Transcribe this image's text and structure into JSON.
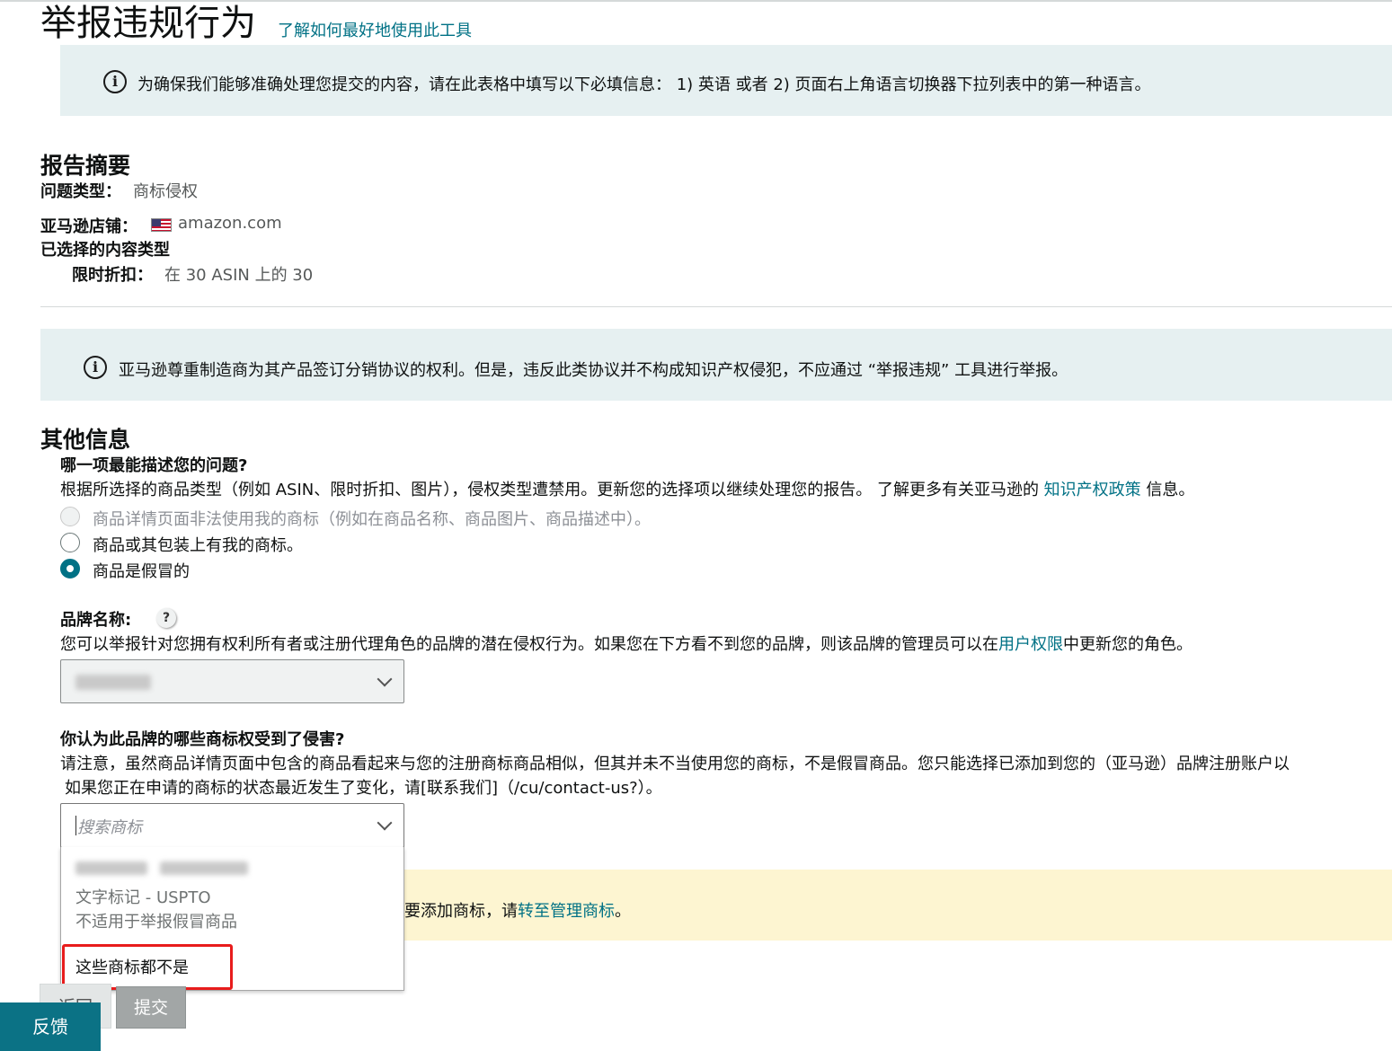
{
  "header": {
    "title": "举报违规行为",
    "help_link": "了解如何最好地使用此工具"
  },
  "language_notice": "为确保我们能够准确处理您提交的内容，请在此表格中填写以下必填信息： 1) 英语 或者 2) 页面右上角语言切换器下拉列表中的第一种语言。",
  "summary": {
    "heading": "报告摘要",
    "issue_type_label": "问题类型：",
    "issue_type_value": "商标侵权",
    "store_label": "亚马逊店铺：",
    "store_value": "amazon.com",
    "content_type_label": "已选择的内容类型",
    "deal_label": "限时折扣：",
    "deal_value": "在 30 ASIN 上的 30"
  },
  "distribution_notice": "亚马逊尊重制造商为其产品签订分销协议的权利。但是，违反此类协议并不构成知识产权侵犯，不应通过 “举报违规” 工具进行举报。",
  "other_info": {
    "heading": "其他信息",
    "question": "哪一项最能描述您的问题?",
    "description_before": "根据所选择的商品类型（例如 ASIN、限时折扣、图片），侵权类型遭禁用。更新您的选择项以继续处理您的报告。 了解更多有关亚马逊的 ",
    "description_link": "知识产权政策",
    "description_after": " 信息。",
    "options": [
      "商品详情页面非法使用我的商标（例如在商品名称、商品图片、商品描述中）。",
      "商品或其包装上有我的商标。",
      "商品是假冒的"
    ]
  },
  "brand": {
    "label": "品牌名称:",
    "help_icon": "?",
    "description_before": "您可以举报针对您拥有权利所有者或注册代理角色的品牌的潜在侵权行为。如果您在下方看不到您的品牌，则该品牌的管理员可以在",
    "description_link": "用户权限",
    "description_after": "中更新您的角色。"
  },
  "trademark": {
    "label": "你认为此品牌的哪些商标权受到了侵害?",
    "note_line1": "请注意，虽然商品详情页面中包含的商品看起来与您的注册商标商品相似，但其并未不当使用您的商标，不是假冒商品。您只能选择已添加到您的（亚马逊）品牌注册账户以",
    "note_line2": "如果您正在申请的商标的状态最近发生了变化，请[联系我们]（/cu/contact-us?）。",
    "search_placeholder": "搜索商标",
    "dropdown_item_type": "文字标记 - USPTO",
    "dropdown_item_note": "不适用于举报假冒商品",
    "none_option": "这些商标都不是"
  },
  "warning": {
    "text_before": "要添加商标，请",
    "link": "转至管理商标",
    "text_after": "。"
  },
  "buttons": {
    "back": "返回",
    "submit": "提交",
    "feedback": "反馈"
  },
  "colors": {
    "link": "#007185",
    "info_bg": "#e6f0f1",
    "warning_bg": "#fdf5d1",
    "highlight": "#e81c1c",
    "feedback_bg": "#0b7285"
  }
}
